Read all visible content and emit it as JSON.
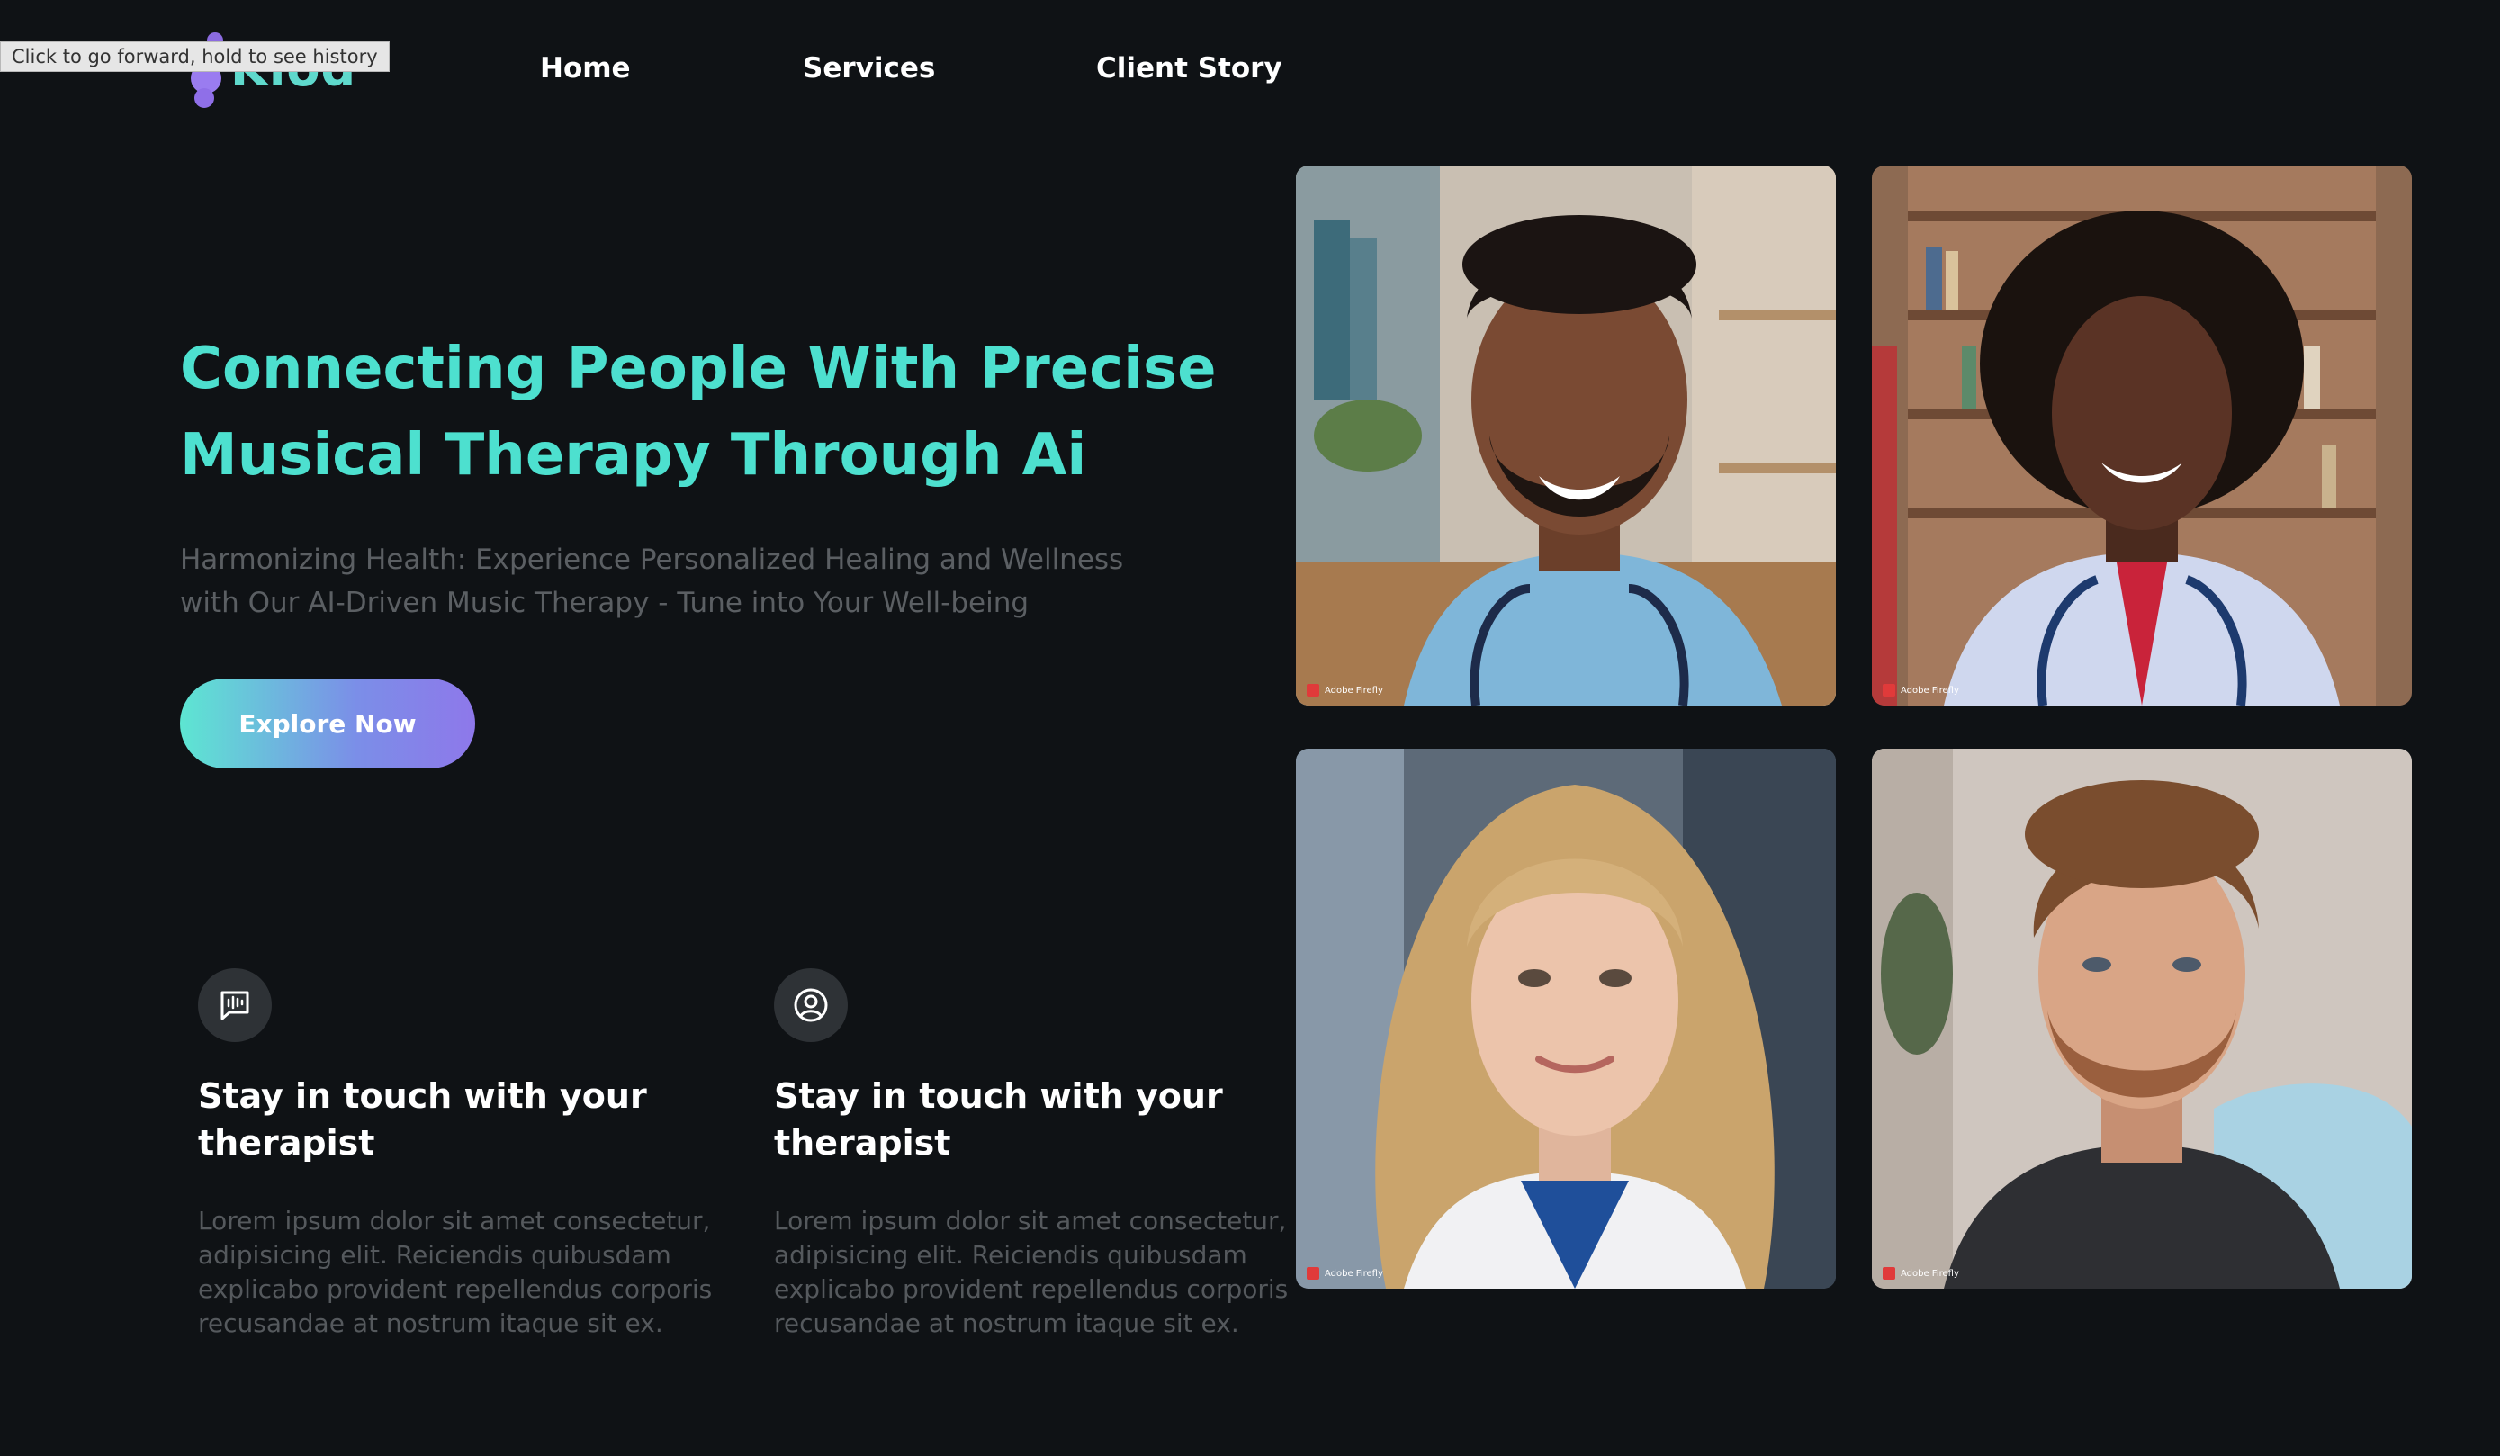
{
  "brand": {
    "name": "Kiod"
  },
  "browser": {
    "tooltip": "Click to go forward, hold to see history"
  },
  "nav": {
    "items": [
      {
        "label": "Home"
      },
      {
        "label": "Services"
      },
      {
        "label": "Client Story"
      }
    ]
  },
  "hero": {
    "title_line1": "Connecting People With Precise",
    "title_line2": "Musical Therapy Through Ai",
    "subtitle_line1": "Harmonizing Health: Experience Personalized Healing and Wellness",
    "subtitle_line2": "with Our AI-Driven Music Therapy - Tune into Your Well-being",
    "cta_label": "Explore Now"
  },
  "features": [
    {
      "icon": "message-waveform-icon",
      "title_line1": "Stay in touch with your",
      "title_line2": "therapist",
      "text": "Lorem ipsum dolor sit amet consectetur, adipisicing elit. Reiciendis quibusdam explicabo provident repellendus corporis recusandae at nostrum itaque sit ex."
    },
    {
      "icon": "user-circle-icon",
      "title_line1": "Stay in touch with your",
      "title_line2": "therapist",
      "text": "Lorem ipsum dolor sit amet consectetur, adipisicing elit. Reiciendis quibusdam explicabo provident repellendus corporis recusandae at nostrum itaque sit ex."
    }
  ],
  "photos": [
    {
      "badge": "Adobe Firefly"
    },
    {
      "badge": "Adobe Firefly"
    },
    {
      "badge": "Adobe Firefly"
    },
    {
      "badge": "Adobe Firefly"
    }
  ],
  "colors": {
    "background": "#0f1215",
    "accent_teal": "#4de0cf",
    "accent_purple": "#8e78ea",
    "muted_text": "#5b5f63"
  }
}
